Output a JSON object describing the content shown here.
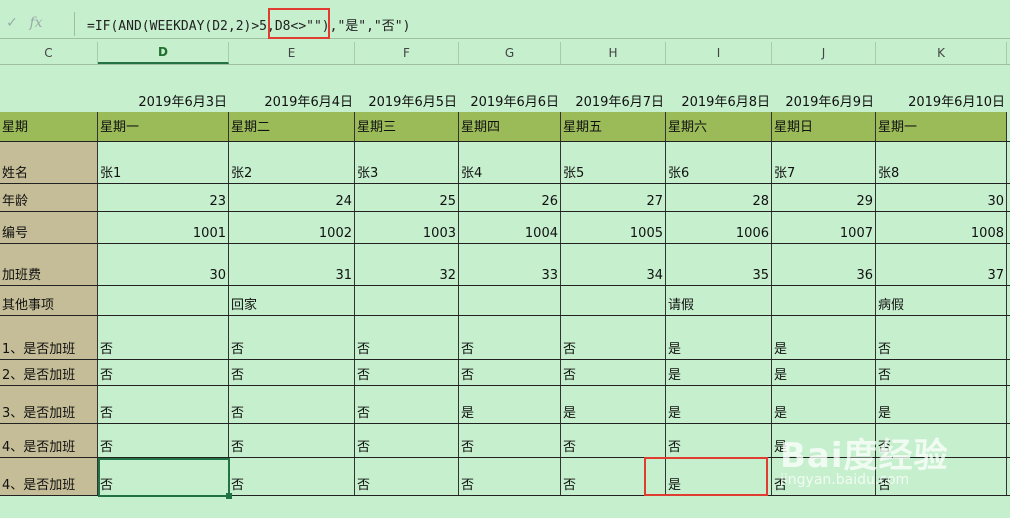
{
  "formula_bar": {
    "cancel_icon": "check-icon",
    "fx_label": "fx",
    "formula": "=IF(AND(WEEKDAY(D2,2)>5,D8<>\"\"),\"是\",\"否\")"
  },
  "columns": [
    "C",
    "D",
    "E",
    "F",
    "G",
    "H",
    "I",
    "J",
    "K"
  ],
  "dates": [
    "2019年6月3日",
    "2019年6月4日",
    "2019年6月5日",
    "2019年6月6日",
    "2019年6月7日",
    "2019年6月8日",
    "2019年6月9日",
    "2019年6月10日"
  ],
  "rows": [
    {
      "label": "星期",
      "values": [
        "星期一",
        "星期二",
        "星期三",
        "星期四",
        "星期五",
        "星期六",
        "星期日",
        "星期一"
      ]
    },
    {
      "label": "姓名",
      "values": [
        "张1",
        "张2",
        "张3",
        "张4",
        "张5",
        "张6",
        "张7",
        "张8"
      ]
    },
    {
      "label": "年龄",
      "values": [
        "23",
        "24",
        "25",
        "26",
        "27",
        "28",
        "29",
        "30"
      ]
    },
    {
      "label": "编号",
      "values": [
        "1001",
        "1002",
        "1003",
        "1004",
        "1005",
        "1006",
        "1007",
        "1008"
      ]
    },
    {
      "label": "加班费",
      "values": [
        "30",
        "31",
        "32",
        "33",
        "34",
        "35",
        "36",
        "37"
      ]
    },
    {
      "label": "其他事项",
      "values": [
        "",
        "回家",
        "",
        "",
        "",
        "请假",
        "",
        "病假"
      ]
    },
    {
      "label": "1、是否加班",
      "values": [
        "否",
        "否",
        "否",
        "否",
        "否",
        "是",
        "是",
        "否"
      ]
    },
    {
      "label": "2、是否加班",
      "values": [
        "否",
        "否",
        "否",
        "否",
        "否",
        "是",
        "是",
        "否"
      ]
    },
    {
      "label": "3、是否加班",
      "values": [
        "否",
        "否",
        "否",
        "是",
        "是",
        "是",
        "是",
        "是"
      ]
    },
    {
      "label": "4、是否加班",
      "values": [
        "否",
        "否",
        "否",
        "否",
        "否",
        "否",
        "是",
        "否"
      ]
    },
    {
      "label": "4、是否加班",
      "values": [
        "否",
        "否",
        "否",
        "否",
        "否",
        "是",
        "否",
        "否"
      ]
    }
  ],
  "watermark": {
    "text": "Bai度经验",
    "sub": "jingyan.baidu.com"
  }
}
